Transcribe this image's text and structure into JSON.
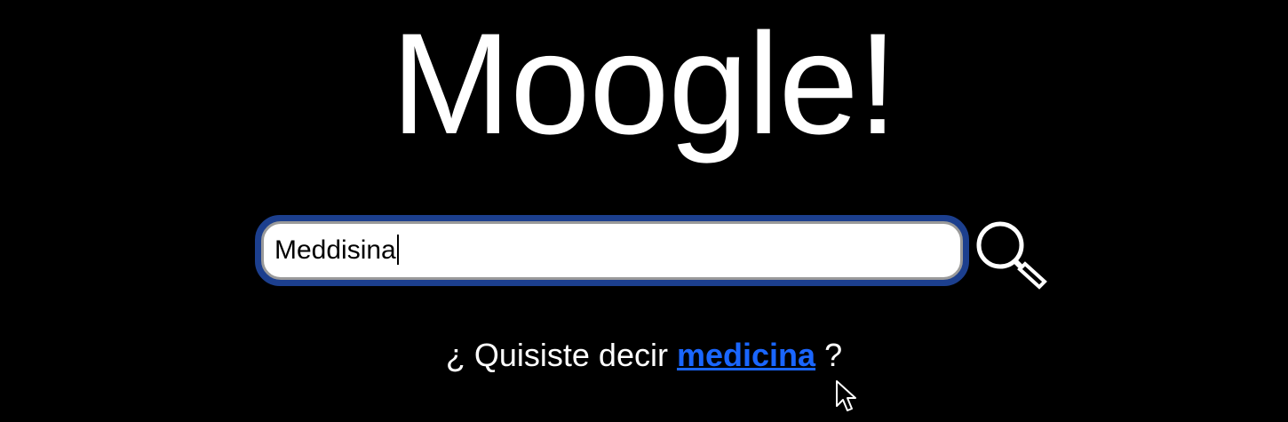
{
  "logo": {
    "text": "Moogle!"
  },
  "search": {
    "value": "Meddisina",
    "button_icon": "magnifier-icon"
  },
  "suggestion": {
    "prefix": "¿ Quisiste decir",
    "link": "medicina",
    "suffix": "?"
  },
  "colors": {
    "background": "#000000",
    "link": "#1a66ff",
    "input_focus_border": "#1c3f8e"
  }
}
